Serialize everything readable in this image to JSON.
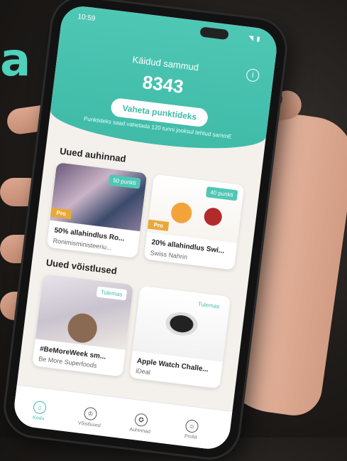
{
  "brand": {
    "partial_text": "a"
  },
  "status_bar": {
    "time": "10:59",
    "icons": "◥ ▮"
  },
  "header": {
    "steps_label": "Käidud sammud",
    "steps_value": "8343",
    "exchange_button": "Vaheta punktideks",
    "exchange_note": "Punktideks saad vahetada 120 tunni jooksul tehtud sammE",
    "info_icon": "i"
  },
  "rewards": {
    "title": "Uued auhinnad",
    "items": [
      {
        "badge": "50 punkti",
        "pro": "Pro",
        "title": "50% allahindlus Ro...",
        "subtitle": "Ronimisministeeriu..."
      },
      {
        "badge": "40 punkti",
        "pro": "Pro",
        "title": "20% allahindlus Swi...",
        "subtitle": "Swiss Nahrin"
      }
    ]
  },
  "competitions": {
    "title": "Uued võistlused",
    "items": [
      {
        "badge": "Tulemas",
        "title": "#BeMoreWeek sm...",
        "subtitle": "Be More Superfoods"
      },
      {
        "badge": "Tulemas",
        "title": "Apple Watch Challe...",
        "subtitle": "iDeal"
      }
    ]
  },
  "tabbar": {
    "items": [
      {
        "label": "Kodu",
        "icon": "home-icon",
        "glyph": "⌂",
        "active": true
      },
      {
        "label": "Võistlused",
        "icon": "trophy-icon",
        "glyph": "♔",
        "active": false
      },
      {
        "label": "Auhinnad",
        "icon": "award-icon",
        "glyph": "✪",
        "active": false
      },
      {
        "label": "Profiil",
        "icon": "profile-icon",
        "glyph": "☺",
        "active": false
      }
    ]
  },
  "colors": {
    "accent": "#4fc7b5",
    "pro": "#e8a93a",
    "background": "#f4f1ec"
  }
}
